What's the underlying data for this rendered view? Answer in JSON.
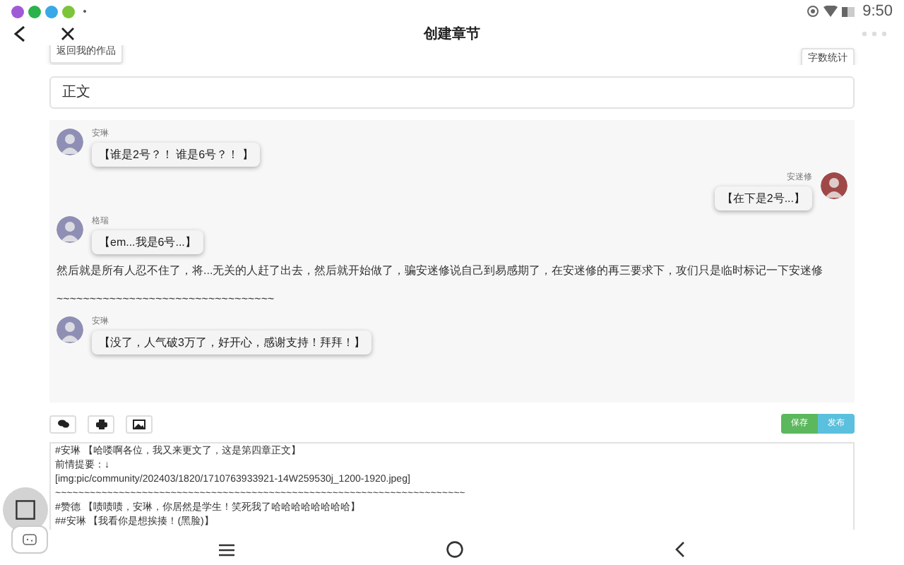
{
  "status_bar": {
    "time": "9:50"
  },
  "header": {
    "title": "创建章节"
  },
  "top_buttons": [
    "返回我的作品",
    "字数统计"
  ],
  "section_field": {
    "value": "正文"
  },
  "preview": [
    {
      "kind": "incoming",
      "speaker": "安琳",
      "text": "【谁是2号？！ 谁是6号？！ 】"
    },
    {
      "kind": "outgoing",
      "speaker": "安迷修",
      "text": "【在下是2号...】"
    },
    {
      "kind": "incoming",
      "speaker": "格瑞",
      "text": "【em...我是6号...】"
    },
    {
      "kind": "text",
      "text": "然后就是所有人忍不住了，将...无关的人赶了出去，然后就开始做了，骗安迷修说自己到易感期了，在安迷修的再三要求下，攻们只是临时标记一下安迷修"
    },
    {
      "kind": "text",
      "text": "~~~~~~~~~~~~~~~~~~~~~~~~~~~~~~~~~"
    },
    {
      "kind": "incoming",
      "speaker": "安琳",
      "text": "【没了，人气破3万了，好开心，感谢支持！拜拜！】"
    }
  ],
  "actions": [
    "保存",
    "发布"
  ],
  "editor_lines": [
    "#安琳 【哈喽啊各位，我又来更文了，这是第四章正文】",
    "前情提要：↓",
    "[img:pic/community/202403/1820/1710763933921-14W259530j_1200-1920.jpeg]",
    "~~~~~~~~~~~~~~~~~~~~~~~~~~~~~~~~~~~~~~~~~~~~~~~~~~~~~~~~~~~~~~~~~~~~~~~",
    "#赞德 【啧啧啧，安琳，你居然是学生！笑死我了哈哈哈哈哈哈哈哈】",
    "##安琳 【我看你是想挨揍！(黑脸)】"
  ]
}
